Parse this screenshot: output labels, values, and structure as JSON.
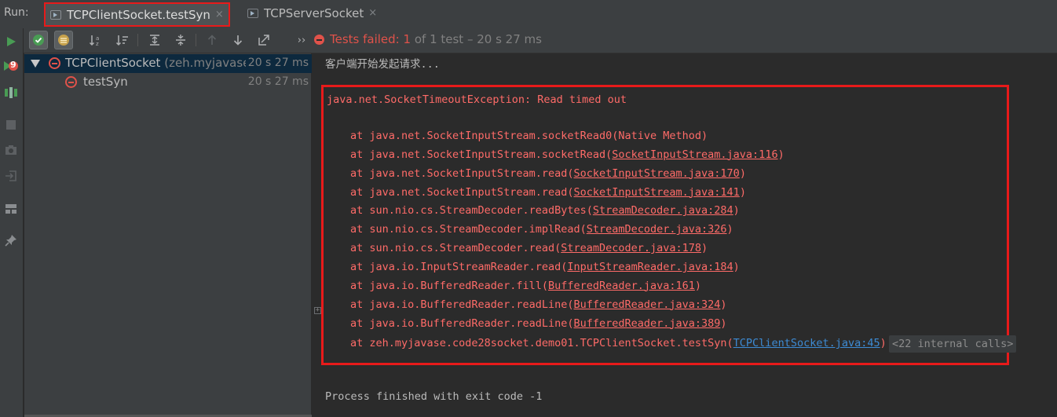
{
  "run_label": "Run:",
  "tabs": [
    {
      "label": "TCPClientSocket.testSyn",
      "close": "×",
      "icon": "test-run-icon"
    },
    {
      "label": "TCPServerSocket",
      "close": "×",
      "icon": "test-run-icon"
    }
  ],
  "toolbar": {
    "more": "››",
    "status_failed": "Tests failed:",
    "status_count": "1",
    "status_rest": "of 1 test – 20 s 27 ms",
    "icons": [
      "show-passed-icon",
      "show-ignored-icon",
      "sort-alpha-icon",
      "sort-duration-icon",
      "expand-all-icon",
      "collapse-all-icon",
      "prev-failure-icon",
      "next-failure-icon",
      "export-icon"
    ]
  },
  "sidebar": {
    "icons": [
      "rerun-icon",
      "rerun-failed-icon",
      "toggle-autotest-icon",
      "stop-icon",
      "camera-icon",
      "import-icon",
      "layout-icon",
      "pin-icon"
    ],
    "rerun_failed_count": "9"
  },
  "tree": {
    "root": {
      "name": "TCPClientSocket",
      "pkg": "(zeh.myjavase.c",
      "time": "20 s 27 ms"
    },
    "child": {
      "name": "testSyn",
      "time": "20 s 27 ms"
    }
  },
  "console": {
    "first_line": "客户端开始发起请求...",
    "exception": "java.net.SocketTimeoutException: Read timed out",
    "stack": [
      {
        "prefix": "at java.net.SocketInputStream.socketRead0(Native Method)",
        "link": "",
        "suffix": ""
      },
      {
        "prefix": "at java.net.SocketInputStream.socketRead(",
        "link": "SocketInputStream.java:116",
        "suffix": ")"
      },
      {
        "prefix": "at java.net.SocketInputStream.read(",
        "link": "SocketInputStream.java:170",
        "suffix": ")"
      },
      {
        "prefix": "at java.net.SocketInputStream.read(",
        "link": "SocketInputStream.java:141",
        "suffix": ")"
      },
      {
        "prefix": "at sun.nio.cs.StreamDecoder.readBytes(",
        "link": "StreamDecoder.java:284",
        "suffix": ")"
      },
      {
        "prefix": "at sun.nio.cs.StreamDecoder.implRead(",
        "link": "StreamDecoder.java:326",
        "suffix": ")"
      },
      {
        "prefix": "at sun.nio.cs.StreamDecoder.read(",
        "link": "StreamDecoder.java:178",
        "suffix": ")"
      },
      {
        "prefix": "at java.io.InputStreamReader.read(",
        "link": "InputStreamReader.java:184",
        "suffix": ")"
      },
      {
        "prefix": "at java.io.BufferedReader.fill(",
        "link": "BufferedReader.java:161",
        "suffix": ")"
      },
      {
        "prefix": "at java.io.BufferedReader.readLine(",
        "link": "BufferedReader.java:324",
        "suffix": ")"
      },
      {
        "prefix": "at java.io.BufferedReader.readLine(",
        "link": "BufferedReader.java:389",
        "suffix": ")"
      }
    ],
    "last_stack": {
      "prefix": "at zeh.myjavase.code28socket.demo01.TCPClientSocket.testSyn(",
      "link": "TCPClientSocket.java:45",
      "suffix": ")"
    },
    "internal_calls": "<22 internal calls>",
    "fold_marker": "+",
    "exit_line": "Process finished with exit code -1"
  },
  "colors": {
    "error": "#ff6b68",
    "link": "#3d8bd4",
    "highlight_box": "#e81a1a",
    "background": "#2b2b2b"
  }
}
